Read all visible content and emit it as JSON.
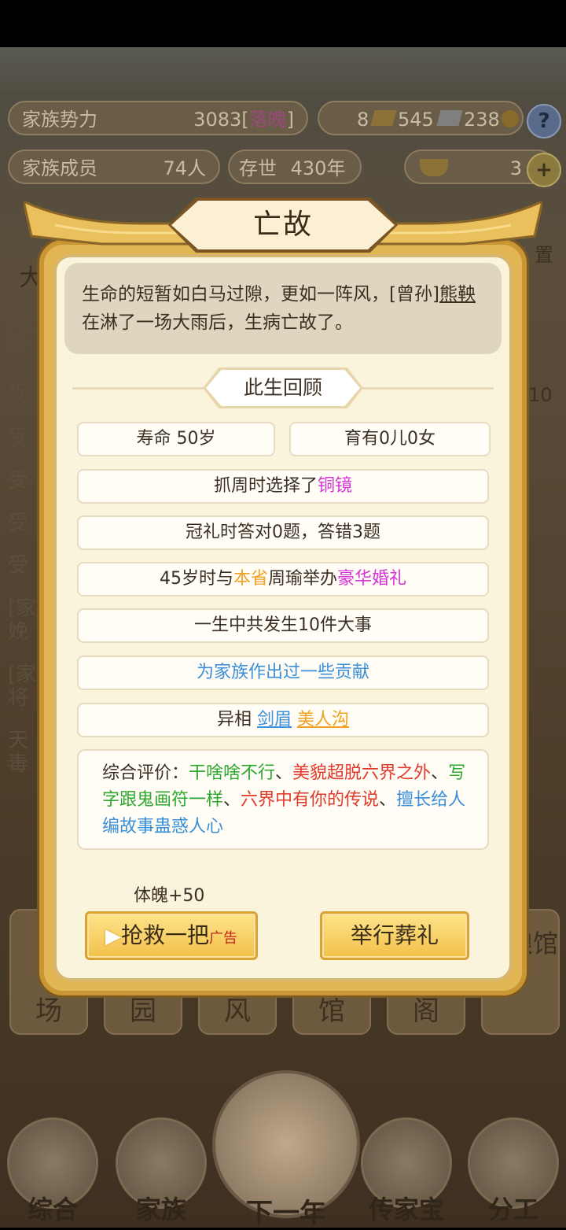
{
  "top_stats": {
    "family_power_label": "家族势力",
    "family_power_value": "3083",
    "family_power_bracket_open": "[",
    "family_power_rank": "落魄",
    "family_power_bracket_close": "]",
    "currency_a": "8",
    "currency_b": "545",
    "currency_c": "238",
    "help": "?",
    "members_label": "家族成员",
    "members_value": "74人",
    "exist_label": "存世",
    "exist_value": "430年",
    "ingot_value": "3",
    "plus": "+"
  },
  "background_side": {
    "partial_left_top": "大",
    "rows": [
      "[伤行",
      "受",
      "受",
      "受",
      "受",
      "受",
      "[家娩",
      "[家将",
      "天毒"
    ],
    "right_number": "10",
    "right_setting": "置"
  },
  "background_tiles": [
    "场",
    "园",
    "风",
    "馆",
    "阁",
    "红娘馆"
  ],
  "bottom_nav": {
    "items": [
      "综合",
      "家族",
      "下一年",
      "传家宝",
      "分工"
    ]
  },
  "modal": {
    "title": "亡故",
    "description_prefix": "生命的短暂如白马过隙，更如一阵风，[曾孙]",
    "description_name": "熊鞅",
    "description_suffix": "在淋了一场大雨后，生病亡故了。",
    "section_title": "此生回顾",
    "lifespan": "寿命 50岁",
    "children": "育有0儿0女",
    "zhuazhou_prefix": "抓周时选择了",
    "zhuazhou_item": "铜镜",
    "guanli": "冠礼时答对0题，答错3题",
    "wedding_prefix": "45岁时与",
    "wedding_place": "本省",
    "wedding_person": "周瑜举办",
    "wedding_type": "豪华婚礼",
    "events": "一生中共发生10件大事",
    "contribution": "为家族作出过一些贡献",
    "traits_label": "异相",
    "trait_1": "剑眉",
    "trait_2": "美人沟",
    "evaluation_label": "综合评价：",
    "eval_1": "干啥啥不行",
    "sep1": "、",
    "eval_2": "美貌超脱六界之外",
    "sep2": "、",
    "eval_3": "写字跟鬼画符一样",
    "sep3": "、",
    "eval_4": "六界中有你的传说",
    "sep4": "、",
    "eval_5": "擅长给人编故事蛊惑人心",
    "bonus": "体魄+50",
    "rescue_button": "抢救一把",
    "rescue_ad": "广告",
    "rescue_play": "▶",
    "funeral_button": "举行葬礼"
  },
  "colors": {
    "accent_gold": "#f2c04a",
    "highlight_magenta": "#d633d6",
    "highlight_orange": "#f0a020",
    "highlight_blue": "#3a8fd8",
    "highlight_green": "#2ea82e",
    "highlight_red": "#e23a2a"
  }
}
